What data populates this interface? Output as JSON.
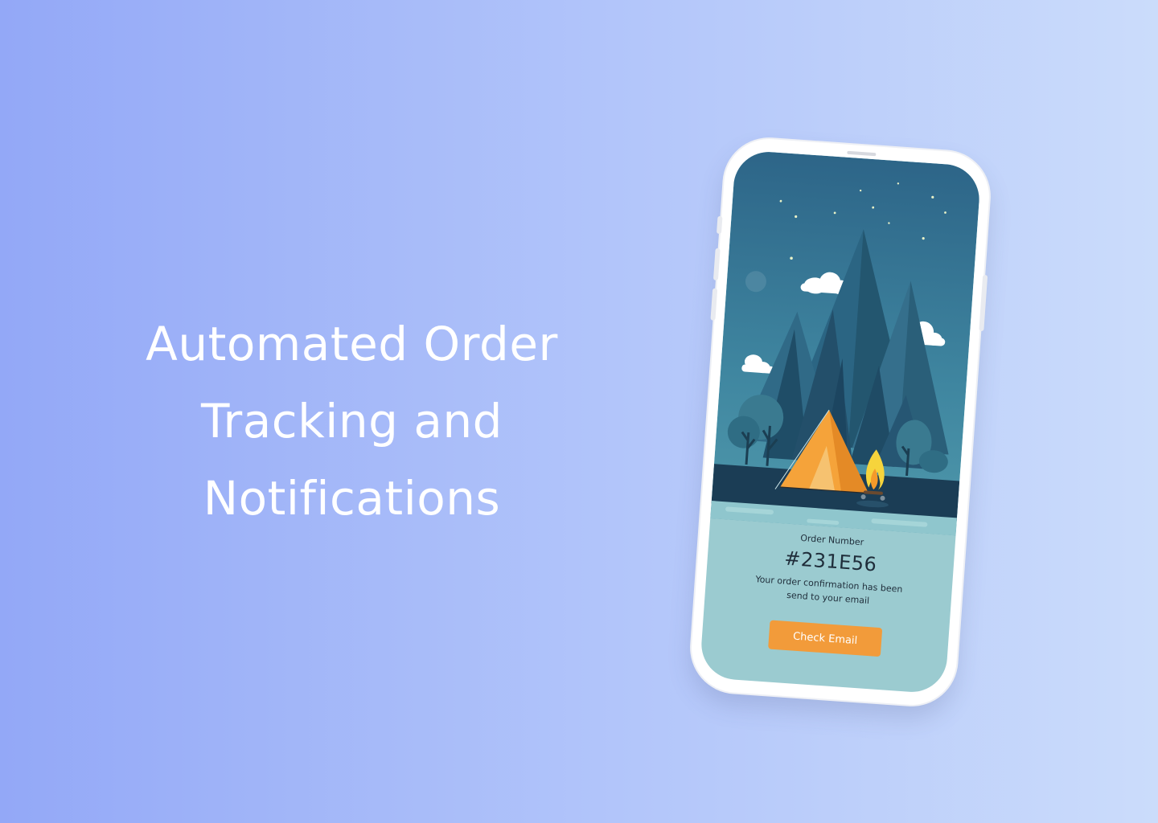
{
  "headline": {
    "line1": "Automated Order",
    "line2": "Tracking and",
    "line3": "Notifications"
  },
  "order": {
    "label": "Order Number",
    "number": "#231E56",
    "description": "Your order confirmation has been send to your email"
  },
  "actions": {
    "check_email_label": "Check Email"
  },
  "colors": {
    "background_start": "#93a8f7",
    "background_end": "#cbdcfb",
    "button": "#f29b3a",
    "sky": "#2f6a8c",
    "tent": "#f5a33a"
  },
  "icons": [
    "moon-icon",
    "cloud-icon",
    "star-icon",
    "campfire-icon",
    "tent-icon"
  ]
}
